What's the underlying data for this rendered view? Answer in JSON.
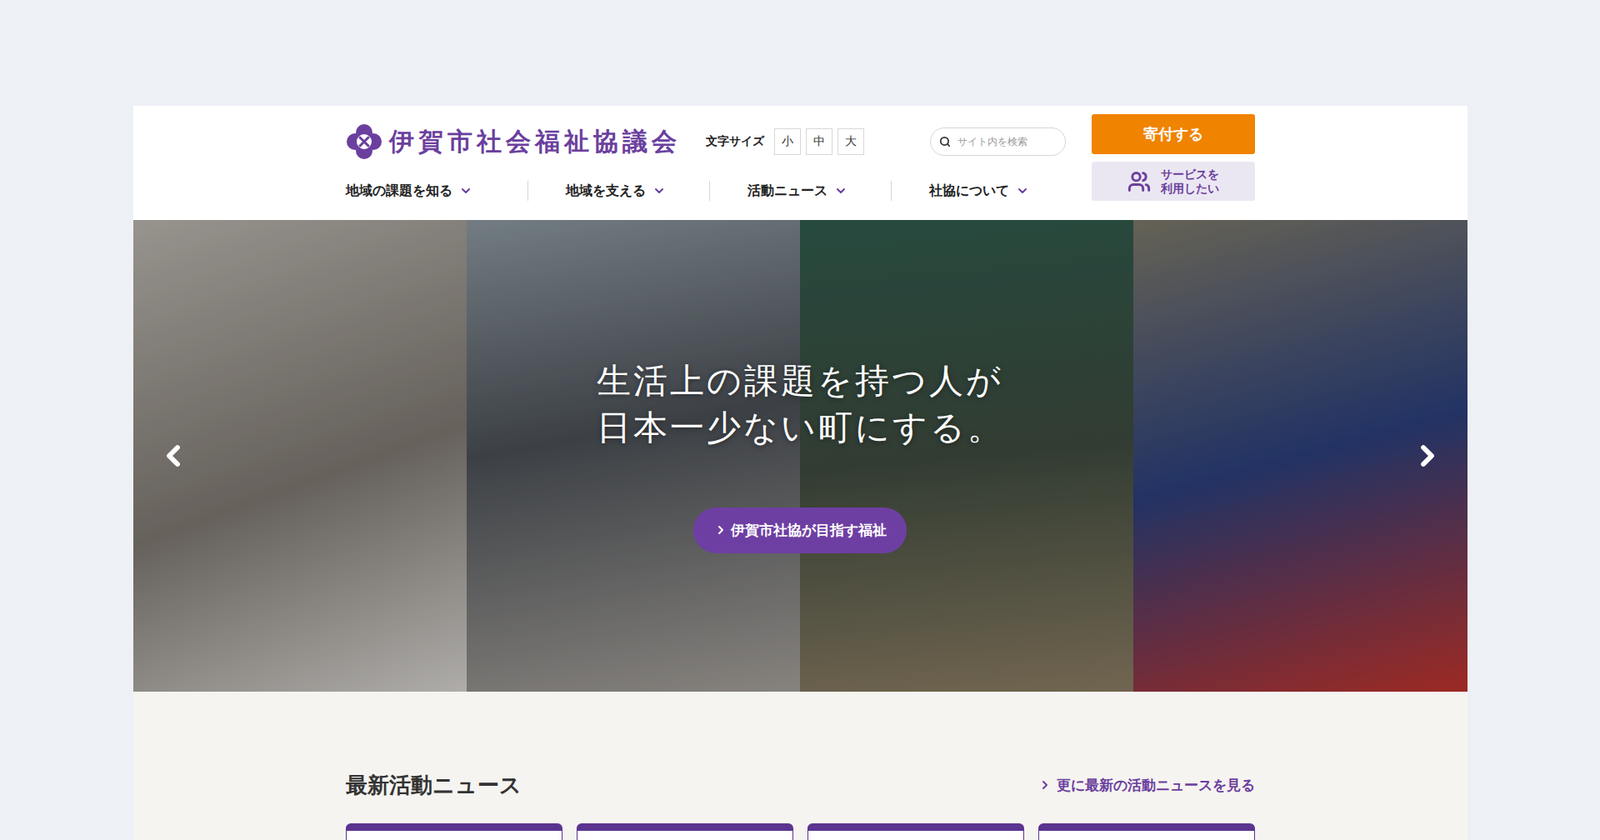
{
  "logo": {
    "text": "伊賀市社会福祉協議会"
  },
  "font_size": {
    "label": "文字サイズ",
    "options": [
      {
        "label": "小",
        "selected": false
      },
      {
        "label": "中",
        "selected": false
      },
      {
        "label": "大",
        "selected": false
      }
    ]
  },
  "search": {
    "placeholder": "サイト内を検索"
  },
  "actions": {
    "donate": "寄付する",
    "service": [
      "サービスを",
      "利用したい"
    ]
  },
  "nav": [
    {
      "label": "地域の課題を知る",
      "expanded": false
    },
    {
      "label": "地域を支える",
      "expanded": false
    },
    {
      "label": "活動ニュース",
      "expanded": false
    },
    {
      "label": "社協について",
      "expanded": false
    }
  ],
  "hero": {
    "headline": [
      "生活上の課題を持つ人が",
      "日本一少ない町にする。"
    ],
    "cta": "伊賀市社協が目指す福祉"
  },
  "news": {
    "title": "最新活動ニュース",
    "more": "更に最新の活動ニュースを見る"
  }
}
